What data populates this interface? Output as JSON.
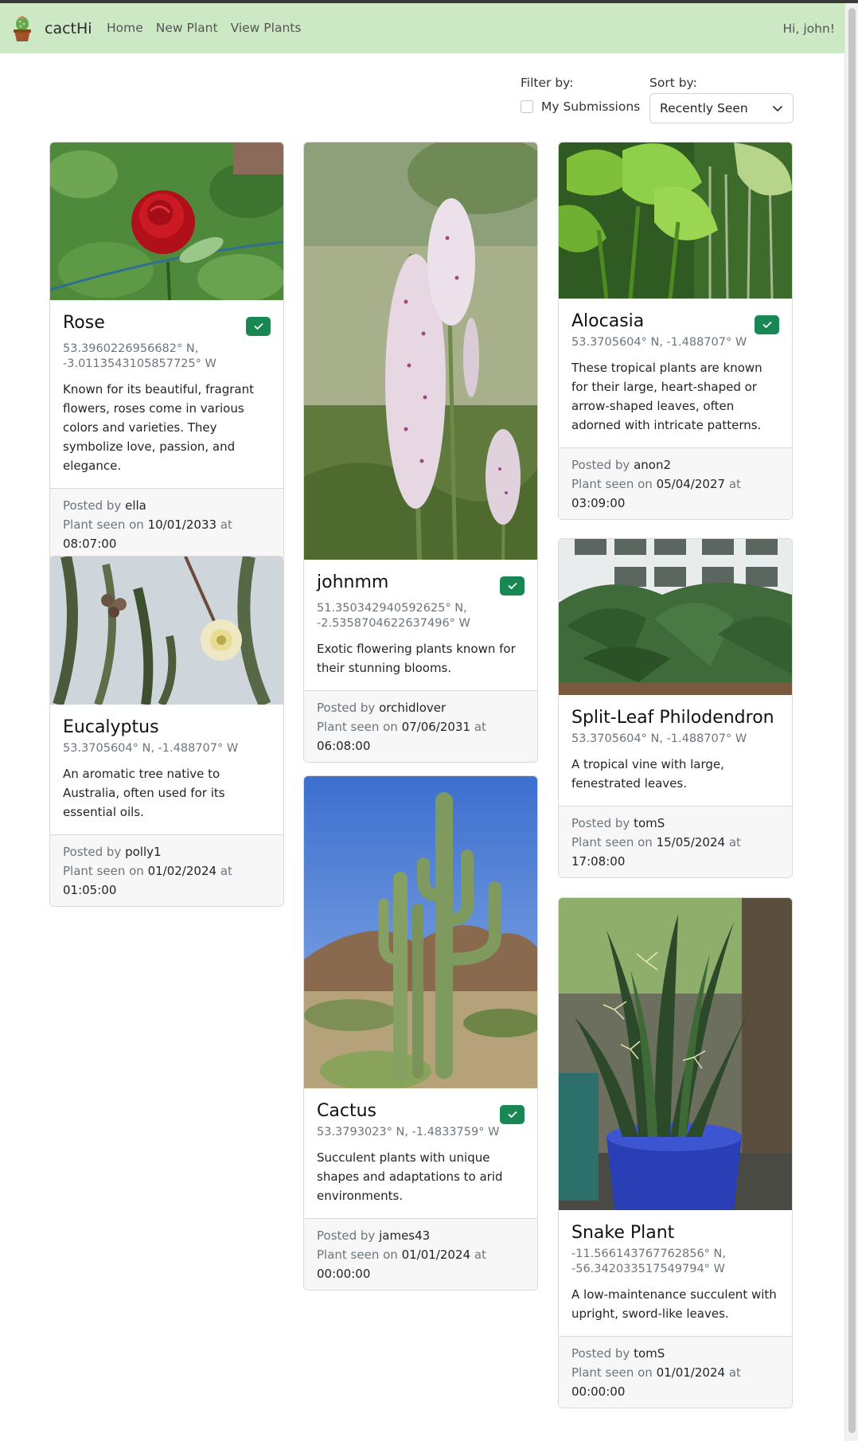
{
  "app": {
    "name": "cactHi",
    "nav": [
      "Home",
      "New Plant",
      "View Plants"
    ],
    "greeting": "Hi, john!"
  },
  "controls": {
    "filter_label": "Filter by:",
    "checkbox_label": "My Submissions",
    "checkbox_checked": false,
    "sort_label": "Sort by:",
    "sort_value": "Recently Seen"
  },
  "footer_labels": {
    "posted_by": "Posted by",
    "seen_on": "Plant seen on",
    "at": "at"
  },
  "cards": [
    {
      "title": "Rose",
      "verified": true,
      "coords": "53.3960226956682° N, -3.0113543105857725° W",
      "description": "Known for its beautiful, fragrant flowers, roses come in various colors and varieties. They symbolize love, passion, and elegance.",
      "posted_by": "ella",
      "date": "10/01/2033",
      "time": "08:07:00"
    },
    {
      "title": "Eucalyptus",
      "verified": false,
      "coords": "53.3705604° N, -1.488707° W",
      "description": "An aromatic tree native to Australia, often used for its essential oils.",
      "posted_by": "polly1",
      "date": "01/02/2024",
      "time": "01:05:00"
    },
    {
      "title": "johnmm",
      "verified": true,
      "coords": "51.350342940592625° N, -2.5358704622637496° W",
      "description": "Exotic flowering plants known for their stunning blooms.",
      "posted_by": "orchidlover",
      "date": "07/06/2031",
      "time": "06:08:00"
    },
    {
      "title": "Cactus",
      "verified": true,
      "coords": "53.3793023° N, -1.4833759° W",
      "description": "Succulent plants with unique shapes and adaptations to arid environments.",
      "posted_by": "james43",
      "date": "01/01/2024",
      "time": "00:00:00"
    },
    {
      "title": "Alocasia",
      "verified": true,
      "coords": "53.3705604° N, -1.488707° W",
      "description": "These tropical plants are known for their large, heart-shaped or arrow-shaped leaves, often adorned with intricate patterns.",
      "posted_by": "anon2",
      "date": "05/04/2027",
      "time": "03:09:00"
    },
    {
      "title": "Split-Leaf Philodendron",
      "verified": false,
      "coords": "53.3705604° N, -1.488707° W",
      "description": "A tropical vine with large, fenestrated leaves.",
      "posted_by": "tomS",
      "date": "15/05/2024",
      "time": "17:08:00"
    },
    {
      "title": "Snake Plant",
      "verified": false,
      "coords": "-11.566143767762856° N, -56.342033517549794° W",
      "description": "A low-maintenance succulent with upright, sword-like leaves.",
      "posted_by": "tomS",
      "date": "01/01/2024",
      "time": "00:00:00"
    }
  ]
}
